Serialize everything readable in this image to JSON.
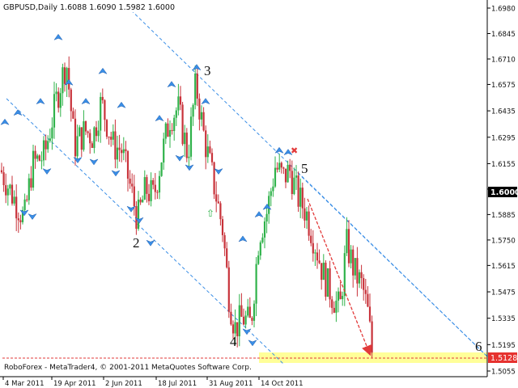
{
  "header": {
    "symbol_text": "GBPUSD,Daily",
    "ohlc_text": "1.6088 1.6090 1.5982 1.6000"
  },
  "footer": {
    "copyright": "RoboForex - MetaTrader4, © 2001-2011 MetaQuotes Software Corp."
  },
  "price_tags": {
    "current": "1.6000",
    "target": "1.5128"
  },
  "colors": {
    "bull": "#2fb24a",
    "bear": "#c8323a",
    "channel": "#3a8ee6",
    "arrow": "#e23a3a",
    "target_zone": "#ffff99",
    "wick": "#222222"
  },
  "chart_data": {
    "type": "candlestick",
    "title": "GBPUSD,Daily",
    "ylim": [
      1.5055,
      1.698
    ],
    "y_ticks": [
      "1.6980",
      "1.6845",
      "1.6710",
      "1.6575",
      "1.6435",
      "1.6295",
      "1.6155",
      "1.6020",
      "1.5885",
      "1.5750",
      "1.5615",
      "1.5475",
      "1.5335",
      "1.5195",
      "1.5055"
    ],
    "x_ticks": [
      "4 Mar 2011",
      "19 Apr 2011",
      "2 Jun 2011",
      "18 Jul 2011",
      "31 Aug 2011",
      "14 Oct 2011"
    ],
    "wave_labels": [
      "3",
      "5",
      "2",
      "4",
      "6"
    ],
    "current_price": 1.6,
    "target_price": 1.5128,
    "series": [
      {
        "values": [
          [
            1,
            1.612
          ],
          [
            14,
            1.6
          ],
          [
            30,
            1.586
          ],
          [
            40,
            1.615
          ],
          [
            55,
            1.62
          ],
          [
            70,
            1.65
          ],
          [
            82,
            1.67
          ],
          [
            92,
            1.625
          ],
          [
            105,
            1.633
          ],
          [
            115,
            1.63
          ],
          [
            125,
            1.648
          ],
          [
            140,
            1.625
          ],
          [
            150,
            1.623
          ],
          [
            160,
            1.605
          ],
          [
            170,
            1.586
          ],
          [
            180,
            1.602
          ],
          [
            190,
            1.598
          ],
          [
            200,
            1.62
          ],
          [
            210,
            1.64
          ],
          [
            220,
            1.645
          ],
          [
            232,
            1.62
          ],
          [
            242,
            1.658
          ],
          [
            252,
            1.63
          ],
          [
            265,
            1.603
          ],
          [
            275,
            1.581
          ],
          [
            283,
            1.545
          ],
          [
            290,
            1.528
          ],
          [
            300,
            1.534
          ],
          [
            310,
            1.53
          ],
          [
            320,
            1.578
          ],
          [
            330,
            1.59
          ],
          [
            340,
            1.614
          ],
          [
            350,
            1.608
          ],
          [
            358,
            1.612
          ],
          [
            368,
            1.598
          ],
          [
            378,
            1.59
          ],
          [
            390,
            1.572
          ],
          [
            400,
            1.556
          ],
          [
            410,
            1.546
          ],
          [
            420,
            1.538
          ],
          [
            428,
            1.573
          ],
          [
            438,
            1.558
          ],
          [
            448,
            1.55
          ],
          [
            455,
            1.535
          ],
          [
            461,
            1.51
          ]
        ]
      }
    ]
  }
}
